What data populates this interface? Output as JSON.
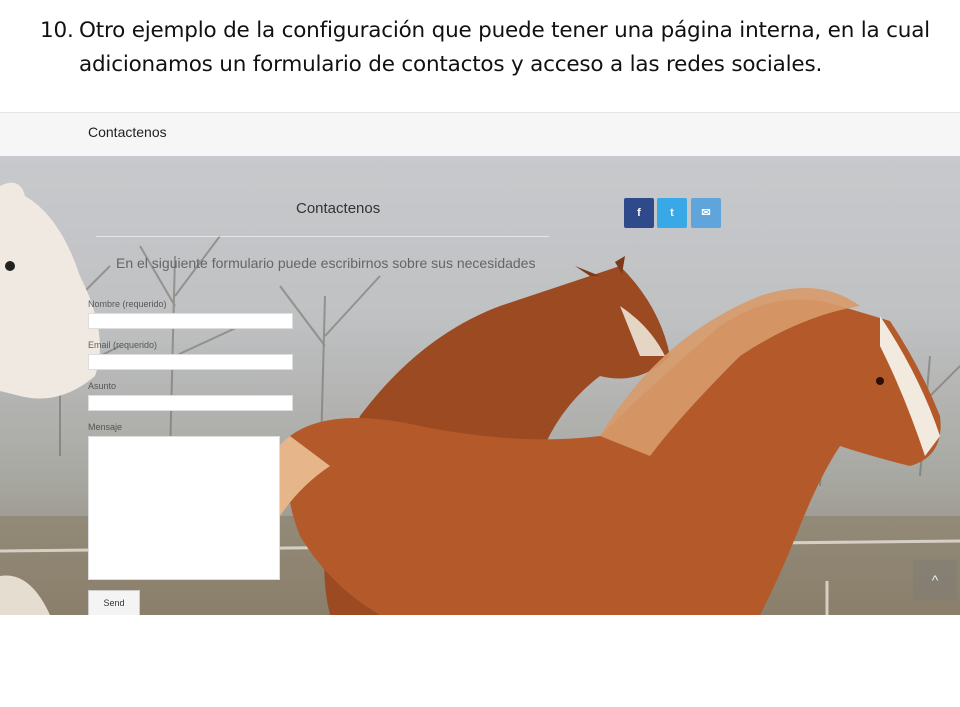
{
  "slide": {
    "number": "10.",
    "line1": "Otro ejemplo de la configuración que puede tener una página interna, en la cual",
    "line2": "adicionamos un formulario de contactos y acceso a las redes sociales."
  },
  "site": {
    "header_title": "Contactenos"
  },
  "content": {
    "title": "Contactenos",
    "intro": "En el siguiente formulario puede escribirnos sobre sus necesidades"
  },
  "social": [
    {
      "label": "f",
      "icon": "facebook-icon",
      "color": "#2e4a8a"
    },
    {
      "label": "t",
      "icon": "twitter-icon",
      "color": "#38a9e6"
    },
    {
      "label": "✉",
      "icon": "email-icon",
      "color": "#5fa5dc"
    }
  ],
  "form": {
    "name_label": "Nombre (requerido)",
    "email_label": "Email (requerido)",
    "subject_label": "Asunto",
    "message_label": "Mensaje",
    "send_label": "Send"
  },
  "scroll_top_icon": "chevron-up-icon"
}
